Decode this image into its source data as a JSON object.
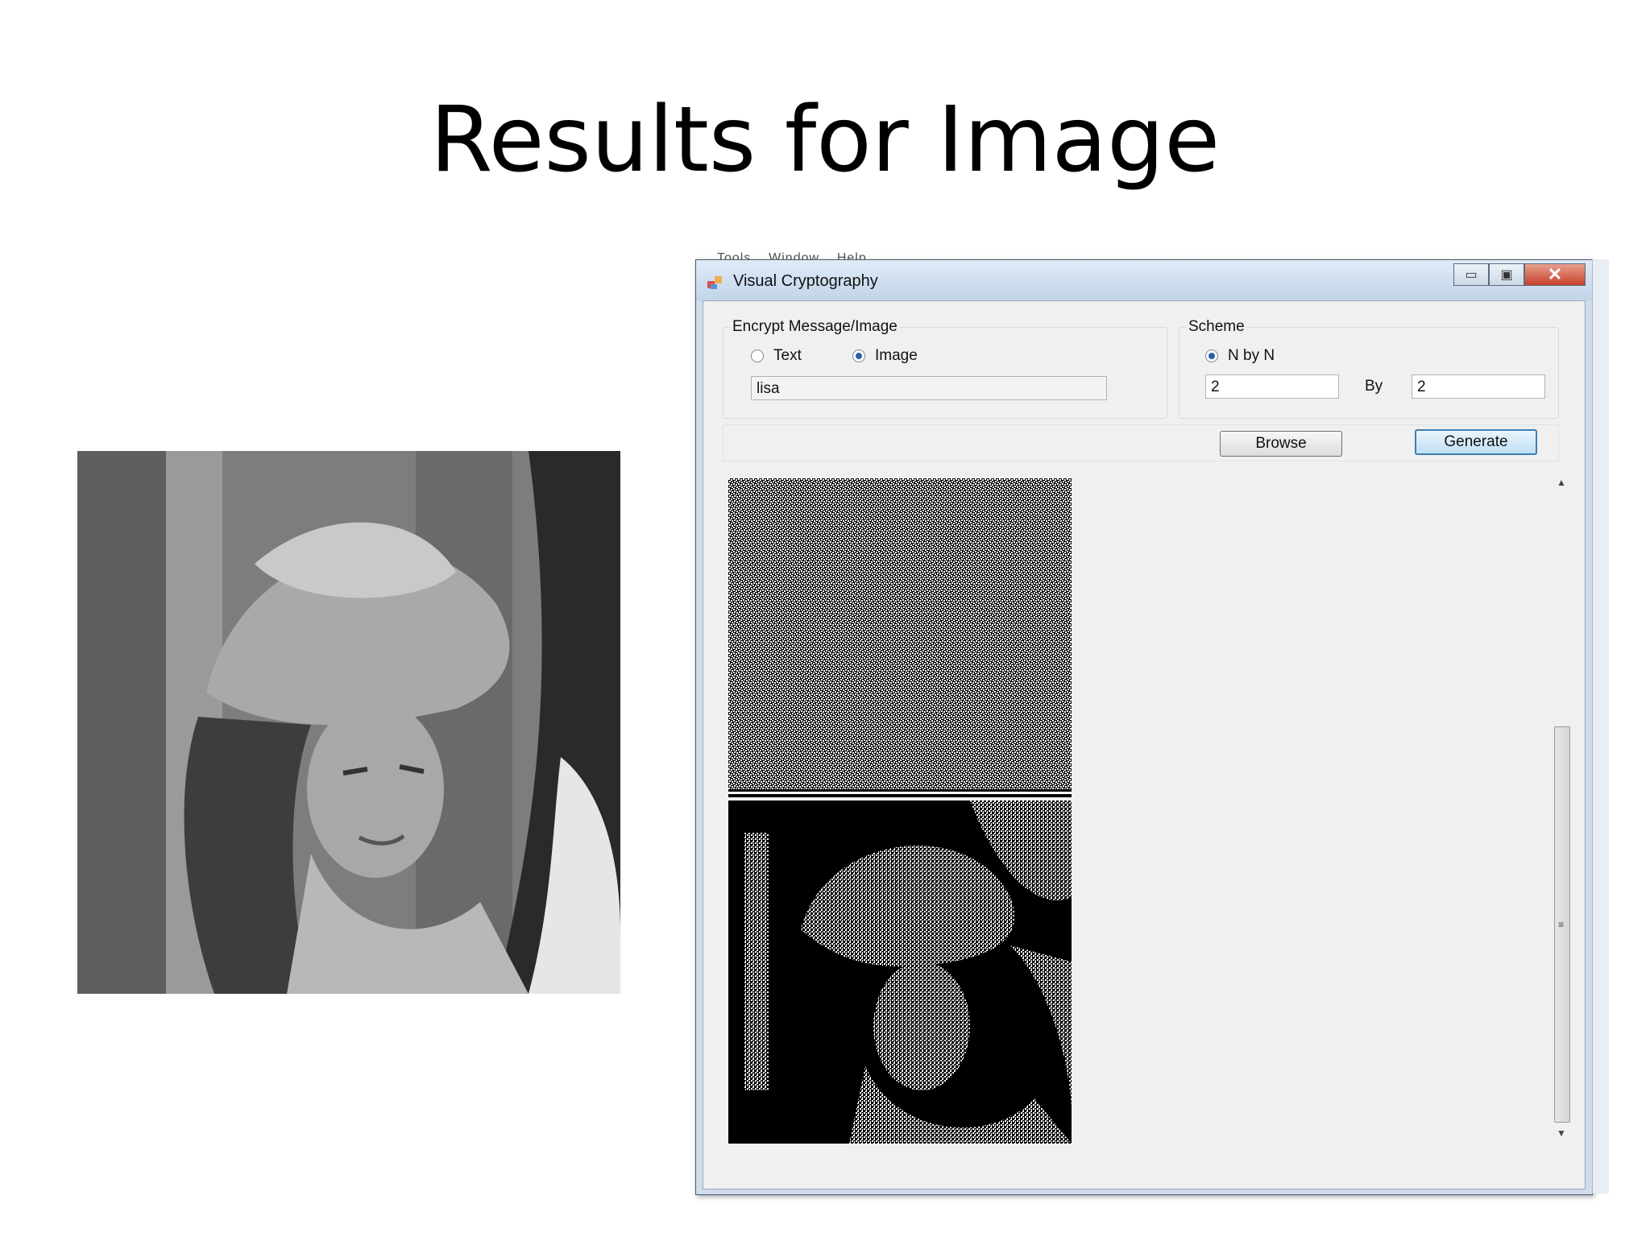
{
  "slide": {
    "title": "Results for Image"
  },
  "background_menu": {
    "items": [
      "Tools",
      "Window",
      "Help"
    ]
  },
  "window": {
    "title": "Visual Cryptography",
    "controls": {
      "minimize": "▭",
      "maximize": "▣",
      "close": "✕"
    }
  },
  "encrypt_group": {
    "label": "Encrypt Message/Image",
    "options": [
      {
        "label": "Text",
        "checked": false
      },
      {
        "label": "Image",
        "checked": true
      }
    ],
    "input_value": "lisa"
  },
  "scheme_group": {
    "label": "Scheme",
    "option": {
      "label": "N by N",
      "checked": true
    },
    "n_value": "2",
    "by_label": "By",
    "m_value": "2"
  },
  "actions": {
    "browse": "Browse",
    "generate": "Generate"
  },
  "colors": {
    "accent": "#2a5fa8",
    "titlebar": "#c2d5ea",
    "close": "#c7402a"
  }
}
